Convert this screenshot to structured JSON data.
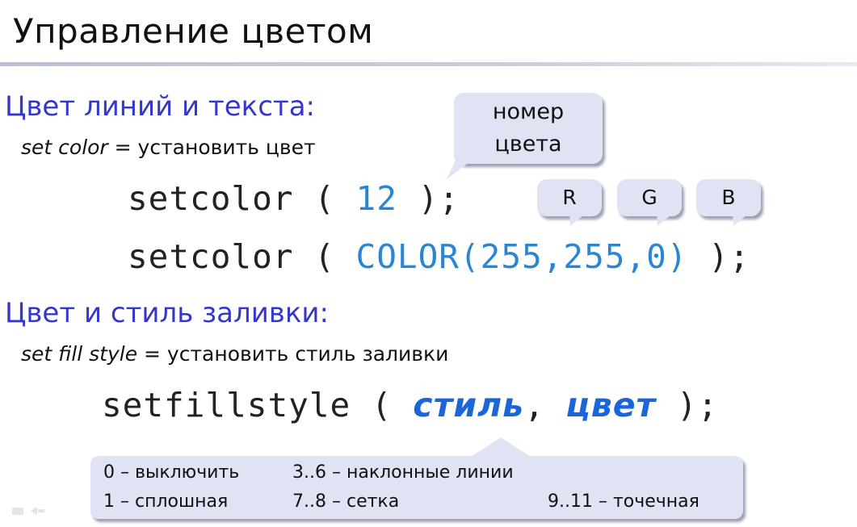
{
  "title": "Управление цветом",
  "section1": {
    "heading": "Цвет линий и текста:",
    "sub_italic": "set color",
    "sub_rest": " = установить цвет",
    "code1": {
      "func": "setcolor",
      "open": " ( ",
      "arg": "12",
      "close": " );"
    },
    "code2": {
      "func": "setcolor",
      "open": " ( ",
      "arg": "COLOR(255,255,0)",
      "close": " );"
    },
    "bubble_number": "номер\nцвета",
    "bubble_r": "R",
    "bubble_g": "G",
    "bubble_b": "B"
  },
  "section2": {
    "heading": "Цвет и стиль заливки:",
    "sub_italic": "set fill style",
    "sub_rest": " = установить стиль заливки",
    "code": {
      "func": "setfillstyle",
      "open": " ( ",
      "arg1": "стиль",
      "comma": ", ",
      "arg2": "цвет",
      "close": " );"
    }
  },
  "legend": {
    "r1c1": "0 – выключить",
    "r1c2": "3..6 – наклонные линии",
    "r2c1": "1 – сплошная",
    "r2c2": "7..8 – сетка",
    "r2c3": "9..11 – точечная"
  },
  "colors": {
    "heading": "#3437c8",
    "code_arg": "#2a86d4",
    "bubble": "#dfe3f4"
  }
}
